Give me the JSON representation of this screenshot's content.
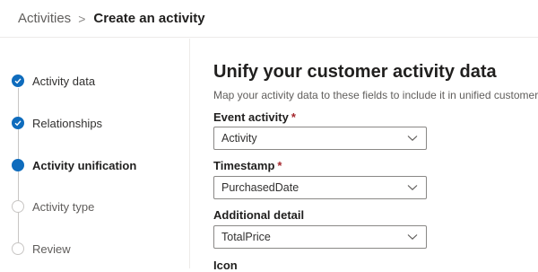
{
  "breadcrumb": {
    "root": "Activities",
    "separator": ">",
    "current": "Create an activity"
  },
  "steps": [
    {
      "label": "Activity data",
      "state": "done"
    },
    {
      "label": "Relationships",
      "state": "done"
    },
    {
      "label": "Activity unification",
      "state": "current"
    },
    {
      "label": "Activity type",
      "state": "pending"
    },
    {
      "label": "Review",
      "state": "pending"
    }
  ],
  "main": {
    "title": "Unify your customer activity data",
    "subtitle": "Map your activity data to these fields to include it in unified customer data:",
    "fields": [
      {
        "label": "Event activity",
        "required_mark": "*",
        "value": "Activity"
      },
      {
        "label": "Timestamp",
        "required_mark": "*",
        "value": "PurchasedDate"
      },
      {
        "label": "Additional detail",
        "required_mark": "",
        "value": "TotalPrice"
      },
      {
        "label": "Icon",
        "required_mark": "",
        "value": ""
      }
    ]
  },
  "colors": {
    "accent": "#0f6cbd",
    "required": "#a4262c"
  },
  "icons": {
    "step_done": "checkmark-icon",
    "dropdown": "chevron-down-icon",
    "breadcrumb_separator": "chevron-right-icon"
  }
}
